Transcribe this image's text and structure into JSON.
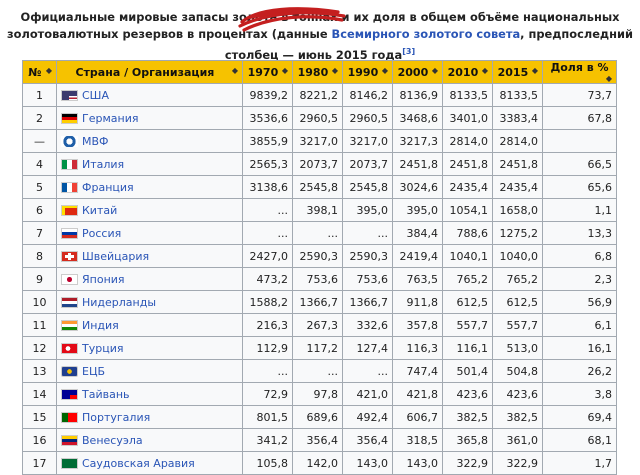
{
  "caption": {
    "text1": "Официальные мировые запасы золота в тоннах и их доля в общем объёме национальных",
    "text2": "золотовалютных резервов в процентах (данные ",
    "link": "Всемирного золотого совета",
    "text3": ", предпоследний",
    "text4": "столбец — июнь 2015 года",
    "ref": "[3]"
  },
  "columns": [
    "№",
    "Страна / Организация",
    "1970",
    "1980",
    "1990",
    "2000",
    "2010",
    "2015",
    "Доля в %"
  ],
  "sort_glyph": "◆",
  "rows": [
    {
      "n": "1",
      "name": "США",
      "flag": "us-flag-icon",
      "v": [
        "9839,2",
        "8221,2",
        "8146,2",
        "8136,9",
        "8133,5",
        "8133,5",
        "73,7"
      ]
    },
    {
      "n": "2",
      "name": "Германия",
      "flag": "de-flag-icon",
      "v": [
        "3536,6",
        "2960,5",
        "2960,5",
        "3468,6",
        "3401,0",
        "3383,4",
        "67,8"
      ]
    },
    {
      "n": "—",
      "name": "МВФ",
      "flag": "imf-logo-icon",
      "v": [
        "3855,9",
        "3217,0",
        "3217,0",
        "3217,3",
        "2814,0",
        "2814,0",
        ""
      ]
    },
    {
      "n": "4",
      "name": "Италия",
      "flag": "it-flag-icon",
      "v": [
        "2565,3",
        "2073,7",
        "2073,7",
        "2451,8",
        "2451,8",
        "2451,8",
        "66,5"
      ]
    },
    {
      "n": "5",
      "name": "Франция",
      "flag": "fr-flag-icon",
      "v": [
        "3138,6",
        "2545,8",
        "2545,8",
        "3024,6",
        "2435,4",
        "2435,4",
        "65,6"
      ]
    },
    {
      "n": "6",
      "name": "Китай",
      "flag": "cn-flag-icon",
      "v": [
        "...",
        "398,1",
        "395,0",
        "395,0",
        "1054,1",
        "1658,0",
        "1,1"
      ]
    },
    {
      "n": "7",
      "name": "Россия",
      "flag": "ru-flag-icon",
      "v": [
        "...",
        "...",
        "...",
        "384,4",
        "788,6",
        "1275,2",
        "13,3"
      ]
    },
    {
      "n": "8",
      "name": "Швейцария",
      "flag": "ch-flag-icon",
      "v": [
        "2427,0",
        "2590,3",
        "2590,3",
        "2419,4",
        "1040,1",
        "1040,0",
        "6,8"
      ]
    },
    {
      "n": "9",
      "name": "Япония",
      "flag": "jp-flag-icon",
      "v": [
        "473,2",
        "753,6",
        "753,6",
        "763,5",
        "765,2",
        "765,2",
        "2,3"
      ]
    },
    {
      "n": "10",
      "name": "Нидерланды",
      "flag": "nl-flag-icon",
      "v": [
        "1588,2",
        "1366,7",
        "1366,7",
        "911,8",
        "612,5",
        "612,5",
        "56,9"
      ]
    },
    {
      "n": "11",
      "name": "Индия",
      "flag": "in-flag-icon",
      "v": [
        "216,3",
        "267,3",
        "332,6",
        "357,8",
        "557,7",
        "557,7",
        "6,1"
      ]
    },
    {
      "n": "12",
      "name": "Турция",
      "flag": "tr-flag-icon",
      "v": [
        "112,9",
        "117,2",
        "127,4",
        "116,3",
        "116,1",
        "513,0",
        "16,1"
      ]
    },
    {
      "n": "13",
      "name": "ЕЦБ",
      "flag": "ecb-logo-icon",
      "v": [
        "...",
        "...",
        "...",
        "747,4",
        "501,4",
        "504,8",
        "26,2"
      ]
    },
    {
      "n": "14",
      "name": "Тайвань",
      "flag": "tw-flag-icon",
      "v": [
        "72,9",
        "97,8",
        "421,0",
        "421,8",
        "423,6",
        "423,6",
        "3,8"
      ]
    },
    {
      "n": "15",
      "name": "Португалия",
      "flag": "pt-flag-icon",
      "v": [
        "801,5",
        "689,6",
        "492,4",
        "606,7",
        "382,5",
        "382,5",
        "69,4"
      ]
    },
    {
      "n": "16",
      "name": "Венесуэла",
      "flag": "ve-flag-icon",
      "v": [
        "341,2",
        "356,4",
        "356,4",
        "318,5",
        "365,8",
        "361,0",
        "68,1"
      ]
    },
    {
      "n": "17",
      "name": "Саудовская Аравия",
      "flag": "sa-flag-icon",
      "v": [
        "105,8",
        "142,0",
        "143,0",
        "143,0",
        "322,9",
        "322,9",
        "1,7"
      ]
    }
  ]
}
